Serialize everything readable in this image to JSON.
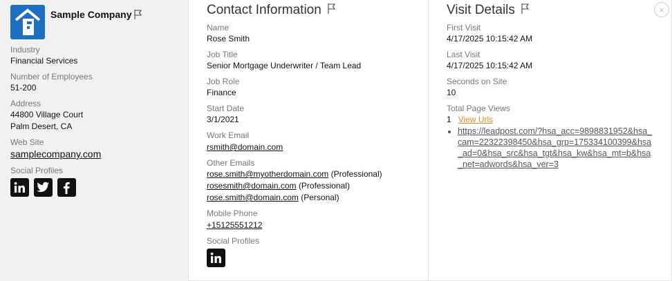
{
  "company": {
    "name": "Sample Company",
    "fields": {
      "industry_label": "Industry",
      "industry": "Financial Services",
      "employees_label": "Number of Employees",
      "employees": "51-200",
      "address_label": "Address",
      "address_line1": "44800 Village Court",
      "address_line2": "Palm Desert, CA",
      "website_label": "Web Site",
      "website": "samplecompany.com",
      "social_label": "Social Profiles"
    },
    "social_icons": [
      "linkedin-icon",
      "twitter-icon",
      "facebook-icon"
    ],
    "logo_color": "#1e6fc2"
  },
  "contact": {
    "title": "Contact Information",
    "name_label": "Name",
    "name": "Rose Smith",
    "job_title_label": "Job Title",
    "job_title": "Senior Mortgage Underwriter / Team Lead",
    "job_role_label": "Job Role",
    "job_role": "Finance",
    "start_date_label": "Start Date",
    "start_date": "3/1/2021",
    "work_email_label": "Work Email",
    "work_email": "rsmith@domain.com",
    "other_emails_label": "Other Emails",
    "other_emails": [
      {
        "email": "rose.smith@myotherdomain.com",
        "type": "(Professional)"
      },
      {
        "email": "rosesmith@domain.com",
        "type": "(Professional)"
      },
      {
        "email": "rose.smith@domain.com",
        "type": "(Personal)"
      }
    ],
    "mobile_label": "Mobile Phone",
    "mobile": "+15125551212",
    "social_label": "Social Profiles"
  },
  "visit": {
    "title": "Visit Details",
    "first_visit_label": "First Visit",
    "first_visit": "4/17/2025 10:15:42 AM",
    "last_visit_label": "Last Visit",
    "last_visit": "4/17/2025 10:15:42 AM",
    "seconds_label": "Seconds on Site",
    "seconds": "10",
    "page_views_label": "Total Page Views",
    "page_views": "1",
    "view_urls": "View Urls",
    "urls": [
      "https://leadpost.com/?hsa_acc=9898831952&hsa_cam=22322398450&hsa_grp=175334100399&hsa_ad=0&hsa_src&hsa_tgt&hsa_kw&hsa_mt=b&hsa_net=adwords&hsa_ver=3"
    ],
    "close_label": "×",
    "accent_color": "#e8892a"
  }
}
